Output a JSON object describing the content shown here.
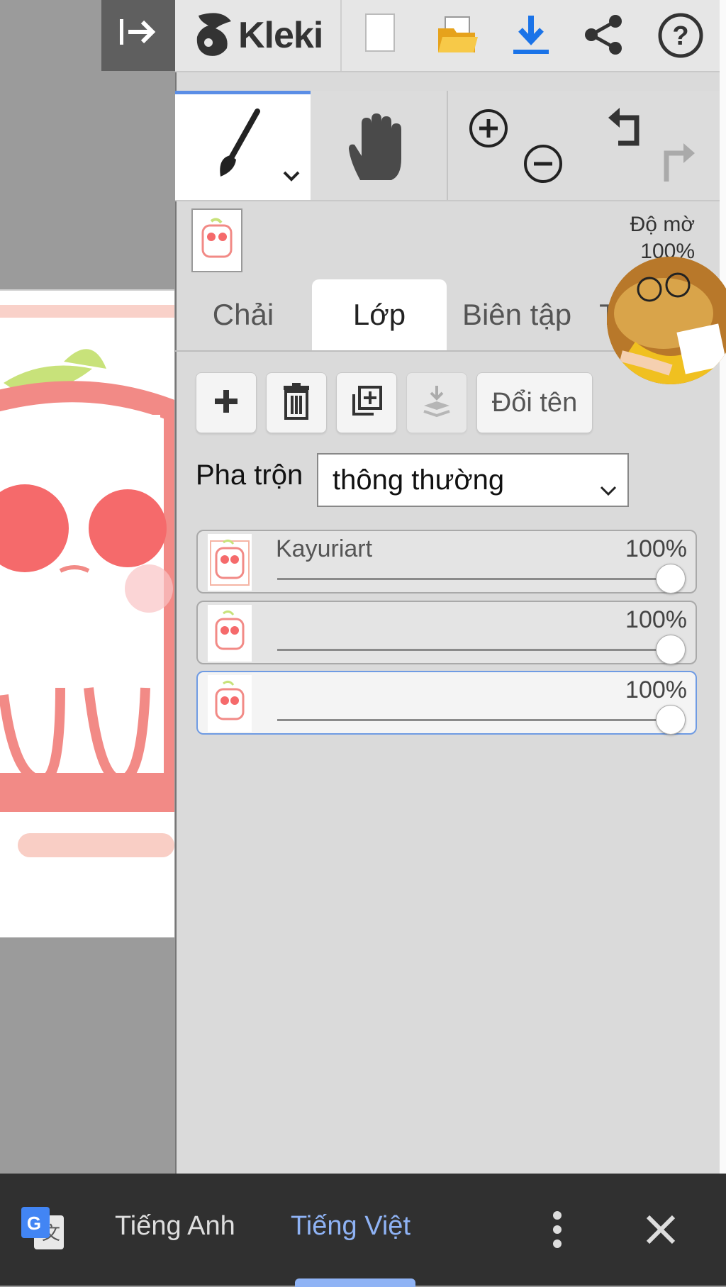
{
  "app": {
    "name": "Kleki"
  },
  "toolbar": {
    "collapse_icon": "collapse-panel-icon",
    "new_icon": "new-file-icon",
    "open_icon": "folder-icon",
    "save_icon": "download-icon",
    "share_icon": "share-icon",
    "help_icon": "help-icon",
    "accent_color": "#1a73e8"
  },
  "tools": {
    "brush_icon": "brush-icon",
    "hand_icon": "hand-icon",
    "zoom_in_icon": "zoom-in-icon",
    "zoom_out_icon": "zoom-out-icon",
    "undo_icon": "undo-icon",
    "redo_icon": "redo-icon"
  },
  "opacity": {
    "label": "Độ mờ",
    "value": "100%"
  },
  "tabs": [
    {
      "label": "Chải"
    },
    {
      "label": "Lớp"
    },
    {
      "label": "Biên tập"
    },
    {
      "label": "T"
    }
  ],
  "layer_actions": {
    "rename_label": "Đổi tên"
  },
  "blend": {
    "label": "Pha trộn",
    "value": "thông thường"
  },
  "layers": [
    {
      "name": "Kayuriart",
      "opacity": "100%",
      "opacity_value": 1.0,
      "selected": false
    },
    {
      "name": "",
      "opacity": "100%",
      "opacity_value": 1.0,
      "selected": false
    },
    {
      "name": "",
      "opacity": "100%",
      "opacity_value": 1.0,
      "selected": true
    }
  ],
  "translate_bar": {
    "source_lang": "Tiếng Anh",
    "target_lang": "Tiếng Việt",
    "accent_color": "#8fb3f5"
  }
}
